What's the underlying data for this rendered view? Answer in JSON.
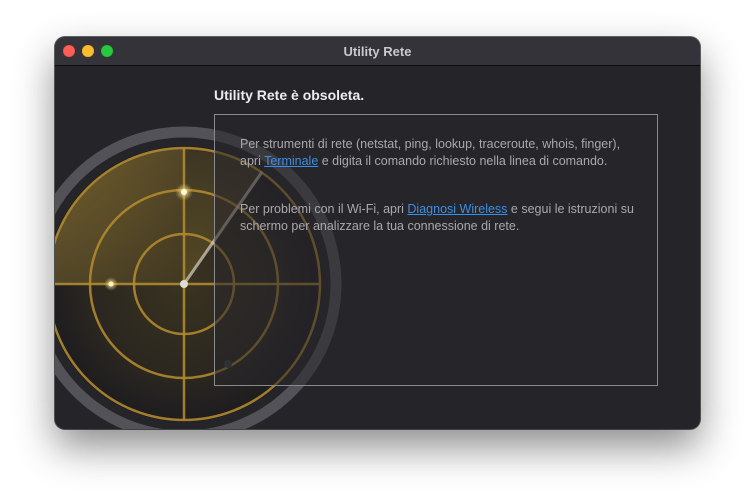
{
  "window": {
    "title": "Utility Rete"
  },
  "heading": "Utility Rete è obsoleta.",
  "message": {
    "p1_before": "Per strumenti di rete (netstat, ping, lookup, traceroute, whois, finger), apri ",
    "p1_link": "Terminale",
    "p1_after": " e digita il comando richiesto nella linea di comando.",
    "p2_before": "Per problemi con il Wi-Fi, apri ",
    "p2_link": "Diagnosi Wireless",
    "p2_after": " e segui le istruzioni su schermo per analizzare la tua connessione di rete."
  },
  "colors": {
    "window_bg": "#232226",
    "titlebar_bg": "#35333a",
    "link": "#3b8fe6",
    "radar_line": "#b08a2e",
    "close": "#fe5f57",
    "minimize": "#febc2e",
    "zoom": "#28c840"
  },
  "icons": {
    "app_icon": "radar-icon"
  }
}
